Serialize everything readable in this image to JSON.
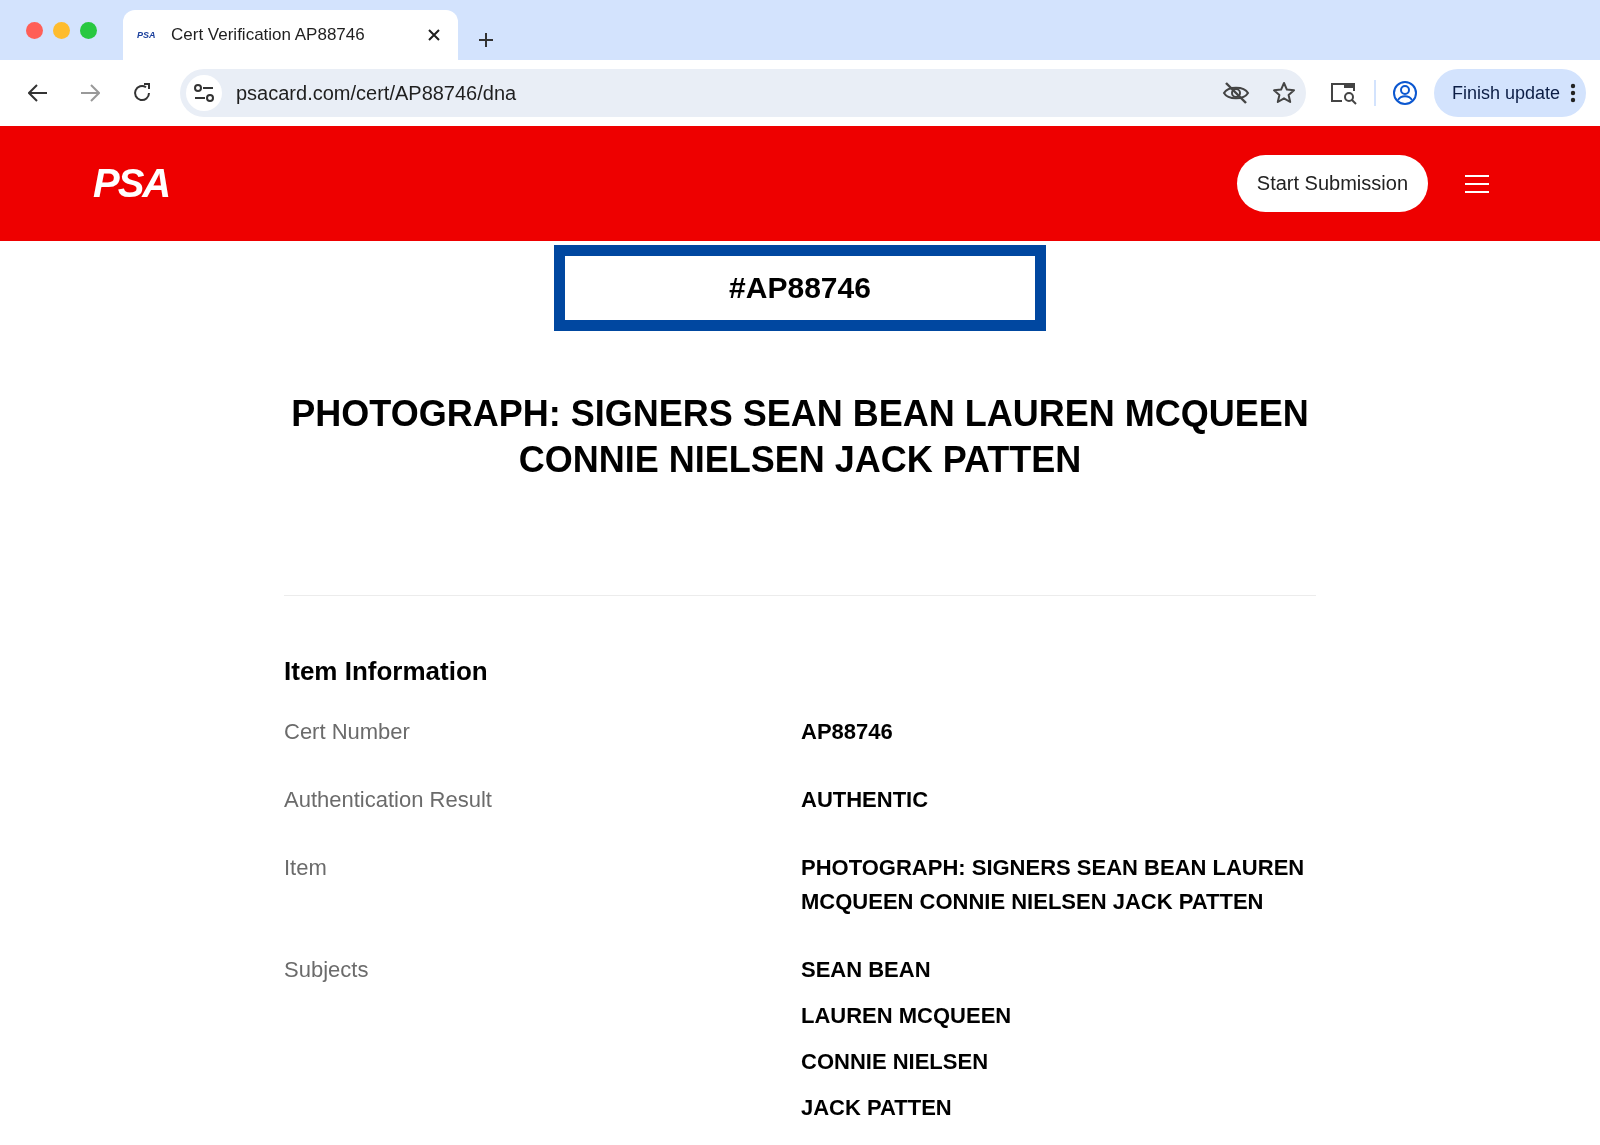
{
  "browser": {
    "tab": {
      "favicon": "PSA",
      "title": "Cert Verification AP88746",
      "selected": true
    },
    "url": "psacard.com/cert/AP88746/dna",
    "update_button": "Finish update"
  },
  "header": {
    "logo": "PSA",
    "submit_button": "Start Submission"
  },
  "cert_banner": "#AP88746",
  "item_title": "PHOTOGRAPH: SIGNERS SEAN BEAN LAUREN MCQUEEN CONNIE NIELSEN JACK PATTEN",
  "item_information": {
    "heading": "Item Information",
    "rows": [
      {
        "label": "Cert Number",
        "values": [
          "AP88746"
        ]
      },
      {
        "label": "Authentication Result",
        "values": [
          "AUTHENTIC"
        ]
      },
      {
        "label": "Item",
        "values": [
          "PHOTOGRAPH: SIGNERS SEAN BEAN LAUREN MCQUEEN CONNIE NIELSEN JACK PATTEN"
        ]
      },
      {
        "label": "Subjects",
        "values": [
          "SEAN BEAN",
          "LAUREN MCQUEEN",
          "CONNIE NIELSEN",
          "JACK PATTEN"
        ]
      }
    ]
  }
}
